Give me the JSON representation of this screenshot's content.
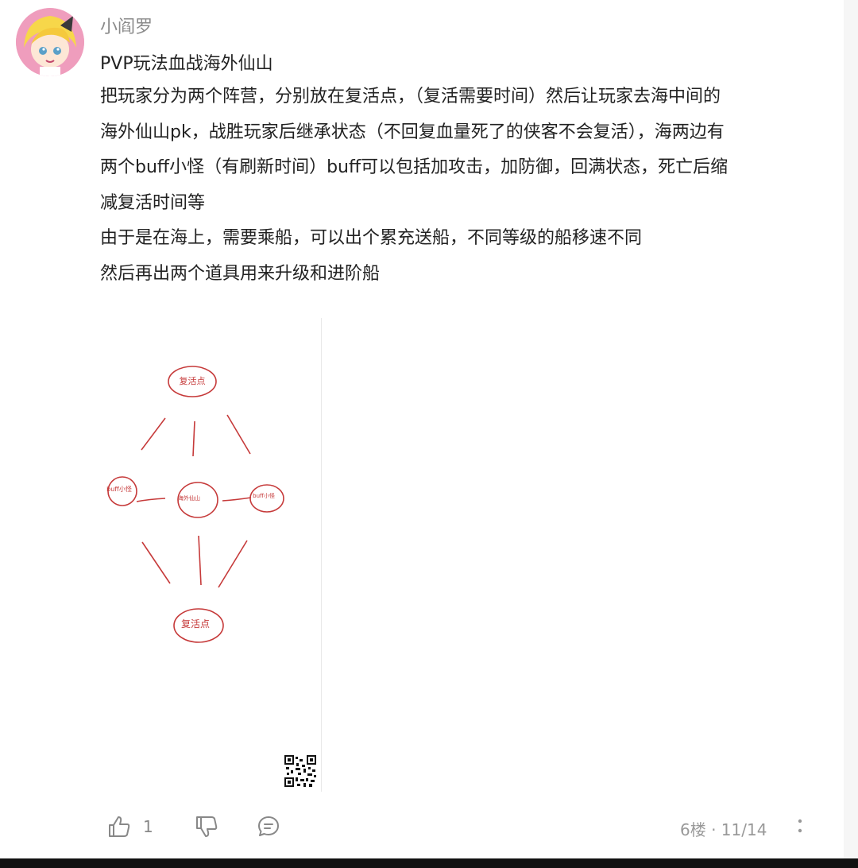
{
  "post": {
    "username": "小阎罗",
    "title": "PVP玩法血战海外仙山",
    "paragraphs": [
      "把玩家分为两个阵营，分别放在复活点，（复活需要时间）然后让玩家去海中间的",
      "海外仙山pk，战胜玩家后继承状态（不回复血量死了的侠客不会复活），海两边有",
      "两个buff小怪（有刷新时间）buff可以包括加攻击，加防御，回满状态，死亡后缩",
      "减复活时间等",
      "由于是在海上，需要乘船，可以出个累充送船，不同等级的船移速不同",
      "然后再出两个道具用来升级和进阶船"
    ]
  },
  "sketch": {
    "top_node": "复活点",
    "left_node": "buff小怪",
    "center_node": "海外仙山",
    "right_node": "buff小怪",
    "bottom_node": "复活点",
    "ink_color": "#c63a3a"
  },
  "actions": {
    "like_count": "1",
    "floor_info": "6楼 · 11/14",
    "icons": [
      "thumbs-up-icon",
      "thumbs-down-icon",
      "comment-icon",
      "more-icon"
    ]
  }
}
